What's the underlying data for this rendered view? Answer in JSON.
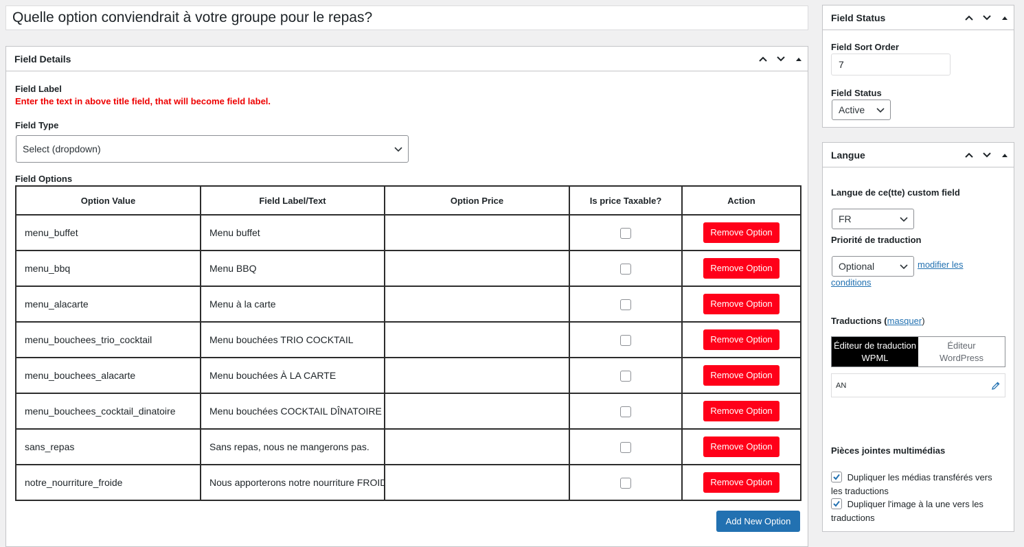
{
  "post_title": "Quelle option conviendrait à votre groupe pour le repas?",
  "details": {
    "title": "Field Details",
    "field_label_heading": "Field Label",
    "field_label_warning": "Enter the text in above title field, that will become field label.",
    "field_type_heading": "Field Type",
    "field_type_value": "Select (dropdown)",
    "field_options_heading": "Field Options",
    "columns": [
      "Option Value",
      "Field Label/Text",
      "Option Price",
      "Is price Taxable?",
      "Action"
    ],
    "rows": [
      {
        "value": "menu_buffet",
        "label": "Menu buffet",
        "price": ""
      },
      {
        "value": "menu_bbq",
        "label": "Menu BBQ",
        "price": ""
      },
      {
        "value": "menu_alacarte",
        "label": "Menu à la carte",
        "price": ""
      },
      {
        "value": "menu_bouchees_trio_cocktail",
        "label": "Menu bouchées TRIO COCKTAIL",
        "price": ""
      },
      {
        "value": "menu_bouchees_alacarte",
        "label": "Menu bouchées À LA CARTE",
        "price": ""
      },
      {
        "value": "menu_bouchees_cocktail_dinatoire",
        "label": "Menu bouchées COCKTAIL DÎNATOIRE",
        "price": ""
      },
      {
        "value": "sans_repas",
        "label": "Sans repas, nous ne mangerons pas.",
        "price": ""
      },
      {
        "value": "notre_nourriture_froide",
        "label": "Nous apporterons notre nourriture FROIDE",
        "price": ""
      }
    ],
    "remove_label": "Remove Option",
    "add_label": "Add New Option"
  },
  "status": {
    "title": "Field Status",
    "sort_order_label": "Field Sort Order",
    "sort_order_value": "7",
    "status_label": "Field Status",
    "status_value": "Active"
  },
  "langue": {
    "title": "Langue",
    "lang_label": "Langue de ce(tte) custom field",
    "lang_value": "FR",
    "priority_label": "Priorité de traduction",
    "priority_value": "Optional",
    "modify_link_1": "modifier les",
    "modify_link_2": "conditions",
    "traductions_label": "Traductions (",
    "masquer_link": "masquer",
    "traductions_close": ")",
    "seg_on_1": "Éditeur de traduction",
    "seg_on_2": "WPML",
    "seg_off_1": "Éditeur",
    "seg_off_2": "WordPress",
    "translation_lang": "AN",
    "media_heading": "Pièces jointes multimédias",
    "dup_media_1": "Dupliquer les médias transférés vers",
    "dup_media_2": "les traductions",
    "dup_image_1": "Dupliquer l'image à la une vers les",
    "dup_image_2": "traductions"
  },
  "icons": [
    "chevron-up-icon",
    "chevron-down-icon",
    "triangle-up-icon",
    "pencil-icon",
    "checkmark-icon"
  ],
  "colors": {
    "remove": "#ff0019",
    "primary": "#2271b1",
    "warning": "#ee0000"
  }
}
